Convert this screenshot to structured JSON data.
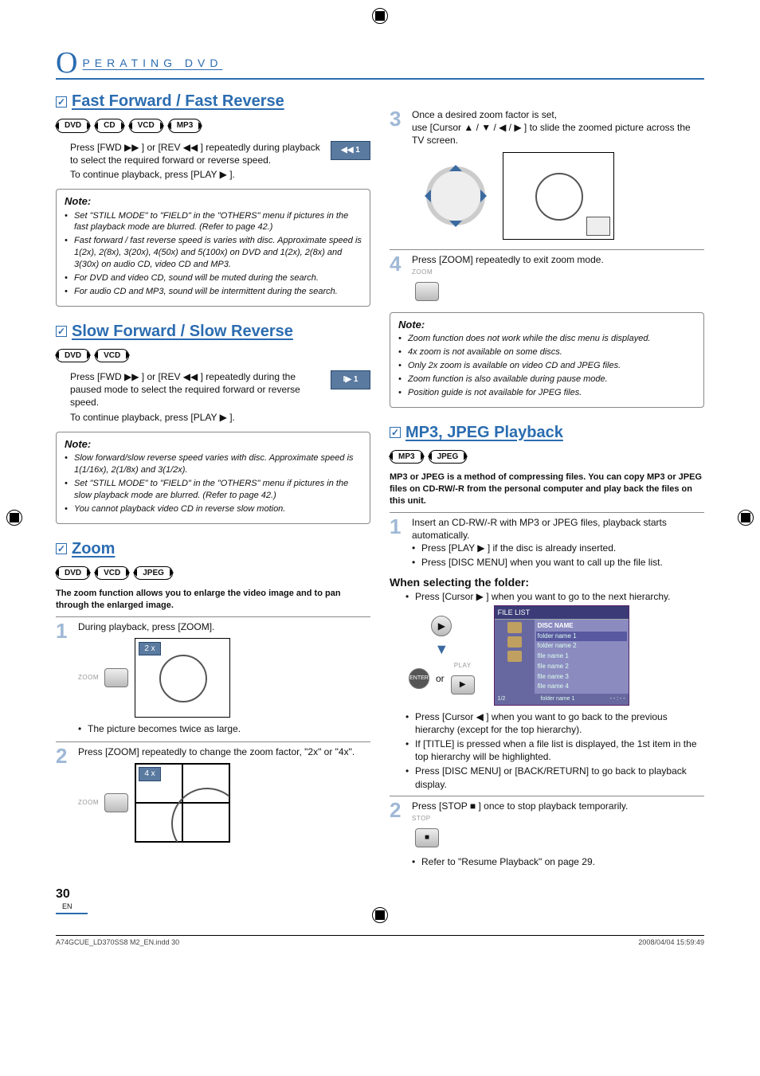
{
  "section_prefix": "O",
  "section_title": "PERATING   DVD",
  "left": {
    "ffr": {
      "title": "Fast Forward / Fast Reverse",
      "pills": [
        "DVD",
        "CD",
        "VCD",
        "MP3"
      ],
      "osd": "◀◀ 1",
      "text1": "Press [FWD ▶▶ ] or [REV ◀◀ ] repeatedly during playback to select the required forward or reverse speed.",
      "text2": "To continue playback, press [PLAY ▶ ].",
      "note_title": "Note:",
      "notes": [
        "Set \"STILL MODE\" to \"FIELD\" in the \"OTHERS\" menu if pictures in the fast playback mode are blurred. (Refer to page 42.)",
        "Fast forward / fast reverse speed is varies with disc. Approximate speed is 1(2x), 2(8x), 3(20x), 4(50x) and 5(100x) on DVD and 1(2x), 2(8x) and 3(30x) on audio CD, video CD and MP3.",
        "For DVD and video CD, sound will be muted during the search.",
        "For audio CD and MP3, sound will be intermittent during the search."
      ]
    },
    "sfr": {
      "title": "Slow Forward / Slow Reverse",
      "pills": [
        "DVD",
        "VCD"
      ],
      "osd": "I▶ 1",
      "text1": "Press [FWD ▶▶ ] or [REV ◀◀ ] repeatedly during the paused mode to select the required forward or reverse speed.",
      "text2": "To continue playback, press [PLAY ▶ ].",
      "note_title": "Note:",
      "notes": [
        "Slow forward/slow reverse speed varies with disc. Approximate speed is 1(1/16x), 2(1/8x) and 3(1/2x).",
        "Set \"STILL MODE\" to \"FIELD\" in the \"OTHERS\" menu if pictures in the slow playback mode are blurred. (Refer to page 42.)",
        "You cannot playback video CD in reverse slow motion."
      ]
    },
    "zoom": {
      "title": "Zoom",
      "pills": [
        "DVD",
        "VCD",
        "JPEG"
      ],
      "intro": "The zoom function allows you to enlarge the video image and to pan through the enlarged image.",
      "step1_num": "1",
      "step1_text": "During playback, press [ZOOM].",
      "step1_illust_tag": "2 x",
      "step1_btn_label": "ZOOM",
      "step1_result": "The picture becomes twice as large.",
      "step2_num": "2",
      "step2_text": "Press [ZOOM] repeatedly to change the zoom factor, \"2x\" or \"4x\".",
      "step2_btn_label": "ZOOM",
      "step2_illust_tag": "4 x"
    }
  },
  "right": {
    "zoom_cont": {
      "step3_num": "3",
      "step3_line1": "Once a desired zoom factor is set,",
      "step3_line2": "use [Cursor ▲ / ▼ / ◀ / ▶ ] to slide the zoomed picture across the TV screen.",
      "step4_num": "4",
      "step4_text": "Press [ZOOM] repeatedly to exit zoom mode.",
      "step4_btn_label": "ZOOM",
      "note_title": "Note:",
      "notes": [
        "Zoom function does not work while the disc menu is displayed.",
        "4x zoom is not available on some discs.",
        "Only 2x zoom is available on video CD and JPEG files.",
        "Zoom function is also available during pause mode.",
        "Position guide is not available for JPEG files."
      ]
    },
    "mp3": {
      "title": "MP3, JPEG Playback",
      "pills": [
        "MP3",
        "JPEG"
      ],
      "intro": "MP3 or JPEG is a method of compressing files. You can copy MP3 or JPEG files on CD-RW/-R from the personal computer and play back the files on this unit.",
      "step1_num": "1",
      "step1_text": "Insert an CD-RW/-R with MP3 or JPEG files, playback starts automatically.",
      "step1_bullets": [
        "Press [PLAY ▶ ] if the disc is already inserted.",
        "Press [DISC MENU] when you want to call up the file list."
      ],
      "subhead": "When selecting the folder:",
      "sub_bullet1": "Press [Cursor ▶ ] when you want to go to the next hierarchy.",
      "enter_label": "ENTER",
      "play_label": "PLAY",
      "or_label": "or",
      "filelist": {
        "header": "FILE LIST",
        "title": "DISC NAME",
        "rows": [
          "folder name 1",
          "folder name 2",
          "file name 1",
          "file name 2",
          "file name 3",
          "file name 4"
        ],
        "footer_left": "1/2",
        "footer_center": "folder name 1",
        "footer_right": "- - : - -"
      },
      "sub_bullets2": [
        "Press [Cursor ◀ ] when you want to go back to the previous hierarchy (except for the top hierarchy).",
        "If [TITLE] is pressed when a file list is displayed, the 1st item in the top hierarchy will be highlighted.",
        "Press [DISC MENU] or [BACK/RETURN] to go back to playback display."
      ],
      "step2_num": "2",
      "step2_text": "Press [STOP ■ ] once to stop playback temporarily.",
      "step2_btn_label": "STOP",
      "step2_bullet": "Refer to \"Resume Playback\" on page 29."
    }
  },
  "page_number": "30",
  "page_lang": "EN",
  "footer_left": "A74GCUE_LD370SS8 M2_EN.indd   30",
  "footer_right": "2008/04/04   15:59:49"
}
